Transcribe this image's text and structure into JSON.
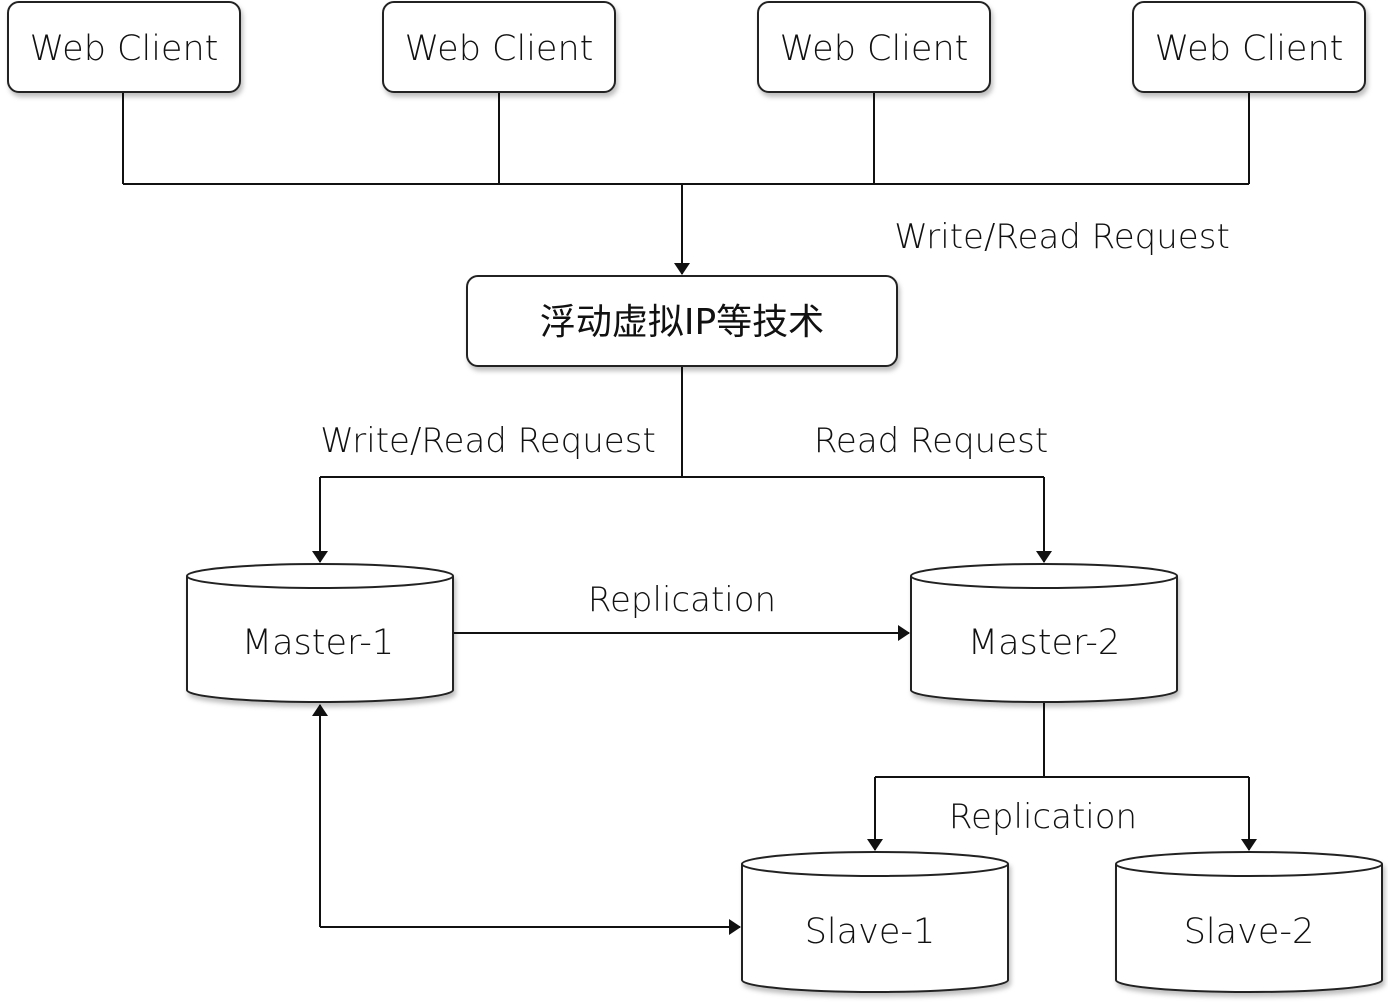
{
  "clients": [
    {
      "label": "Web Client"
    },
    {
      "label": "Web Client"
    },
    {
      "label": "Web Client"
    },
    {
      "label": "Web Client"
    }
  ],
  "vip": {
    "label": "浮动虚拟IP等技术"
  },
  "masters": [
    {
      "label": "Master-1"
    },
    {
      "label": "Master-2"
    }
  ],
  "slaves": [
    {
      "label": "Slave-1"
    },
    {
      "label": "Slave-2"
    }
  ],
  "edge_labels": {
    "clients_to_vip": "Write/Read Request",
    "vip_to_master1": "Write/Read Request",
    "vip_to_master2": "Read Request",
    "master1_to_master2": "Replication",
    "master2_to_slaves": "Replication"
  },
  "colors": {
    "stroke": "#111111",
    "fill": "#ffffff"
  }
}
